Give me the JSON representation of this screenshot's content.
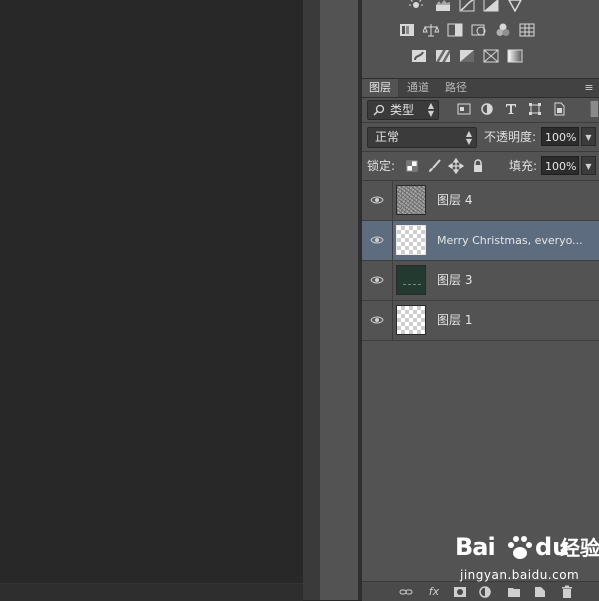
{
  "tabs": [
    {
      "label": "图层",
      "active": true
    },
    {
      "label": "通道",
      "active": false
    },
    {
      "label": "路径",
      "active": false
    }
  ],
  "filter": {
    "label": "类型"
  },
  "blend": {
    "mode": "正常",
    "opacity_label": "不透明度:",
    "opacity_value": "100%"
  },
  "lock": {
    "label": "锁定:",
    "fill_label": "填充:",
    "fill_value": "100%"
  },
  "layers": [
    {
      "name": "图层 4",
      "thumb": "noise",
      "visible": true,
      "selected": false
    },
    {
      "name": "Merry Christmas, everyo...",
      "thumb": "checker",
      "visible": true,
      "selected": true
    },
    {
      "name": "图层 3",
      "thumb": "dark-green",
      "visible": true,
      "selected": false
    },
    {
      "name": "图层 1",
      "thumb": "checker",
      "visible": true,
      "selected": false
    }
  ],
  "colors": {
    "selected_row": "#5e6c80",
    "panel_bg": "#535353",
    "canvas_bg": "#282828"
  },
  "bottom_bar": {
    "fx_label": "fx"
  },
  "watermark": {
    "bai": "Bai",
    "du": "du",
    "jingyan": "经验",
    "url": "jingyan.baidu.com"
  }
}
